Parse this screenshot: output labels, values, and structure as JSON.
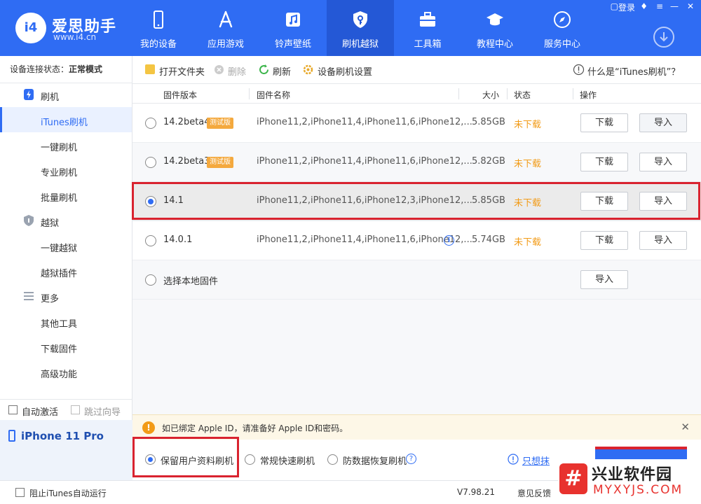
{
  "app": {
    "name": "爱思助手",
    "url": "www.i4.cn",
    "logo_text": "i4"
  },
  "nav": [
    {
      "label": "我的设备",
      "icon": "phone-icon"
    },
    {
      "label": "应用游戏",
      "icon": "app-store-icon"
    },
    {
      "label": "铃声壁纸",
      "icon": "music-icon"
    },
    {
      "label": "刷机越狱",
      "icon": "shield-key-icon",
      "active": true
    },
    {
      "label": "工具箱",
      "icon": "toolbox-icon"
    },
    {
      "label": "教程中心",
      "icon": "graduation-cap-icon"
    },
    {
      "label": "服务中心",
      "icon": "compass-icon"
    }
  ],
  "window": {
    "login": "登录"
  },
  "sidebar": {
    "status_label": "设备连接状态：",
    "status_value": "正常模式",
    "groups": [
      {
        "label": "刷机",
        "icon": "flash-icon",
        "items": [
          "iTunes刷机",
          "一键刷机",
          "专业刷机",
          "批量刷机"
        ]
      },
      {
        "label": "越狱",
        "icon": "jailbreak-shield-icon",
        "items": [
          "一键越狱",
          "越狱插件"
        ]
      },
      {
        "label": "更多",
        "icon": "menu-icon",
        "items": [
          "其他工具",
          "下载固件",
          "高级功能"
        ]
      }
    ],
    "auto_activate": "自动激活",
    "skip_guide": "跳过向导",
    "device_name": "iPhone 11 Pro"
  },
  "toolbar": {
    "open_folder": "打开文件夹",
    "delete": "删除",
    "refresh": "刷新",
    "device_settings": "设备刷机设置",
    "what_is": "什么是“iTunes刷机”？"
  },
  "table": {
    "headers": {
      "version": "固件版本",
      "name": "固件名称",
      "size": "大小",
      "status": "状态",
      "action": "操作"
    },
    "rows": [
      {
        "version": "14.2beta4",
        "tag": "测试版",
        "name": "iPhone11,2,iPhone11,4,iPhone11,6,iPhone12,...",
        "size": "5.85GB",
        "status": "未下载",
        "download": "下载",
        "import": "导入"
      },
      {
        "version": "14.2beta3",
        "tag": "测试版",
        "name": "iPhone11,2,iPhone11,4,iPhone11,6,iPhone12,...",
        "size": "5.82GB",
        "status": "未下载",
        "download": "下载",
        "import": "导入"
      },
      {
        "version": "14.1",
        "tag": "",
        "name": "iPhone11,2,iPhone11,6,iPhone12,3,iPhone12,...",
        "size": "5.85GB",
        "status": "未下载",
        "download": "下载",
        "import": "导入",
        "selected": true
      },
      {
        "version": "14.0.1",
        "tag": "",
        "name": "iPhone11,2,iPhone11,4,iPhone11,6,iPhone12,...",
        "size": "5.74GB",
        "status": "未下载",
        "download": "下载",
        "import": "导入"
      }
    ],
    "local_label": "选择本地固件",
    "local_import": "导入"
  },
  "notice": {
    "text": "如已绑定 Apple ID，请准备好 Apple ID和密码。"
  },
  "modes": {
    "keep_data": "保留用户资料刷机",
    "quick": "常规快速刷机",
    "anti_recovery": "防数据恢复刷机",
    "only_link": "只想抹"
  },
  "statusbar": {
    "block_itunes": "阻止iTunes自动运行",
    "version": "V7.98.21",
    "feedback": "意见反馈"
  },
  "watermark": {
    "mark": "#",
    "title": "兴业软件园",
    "url": "MYXYJS.COM"
  },
  "colors": {
    "accent": "#2f6cf3",
    "warning": "#f29b17",
    "highlight_red": "#d9232f"
  }
}
